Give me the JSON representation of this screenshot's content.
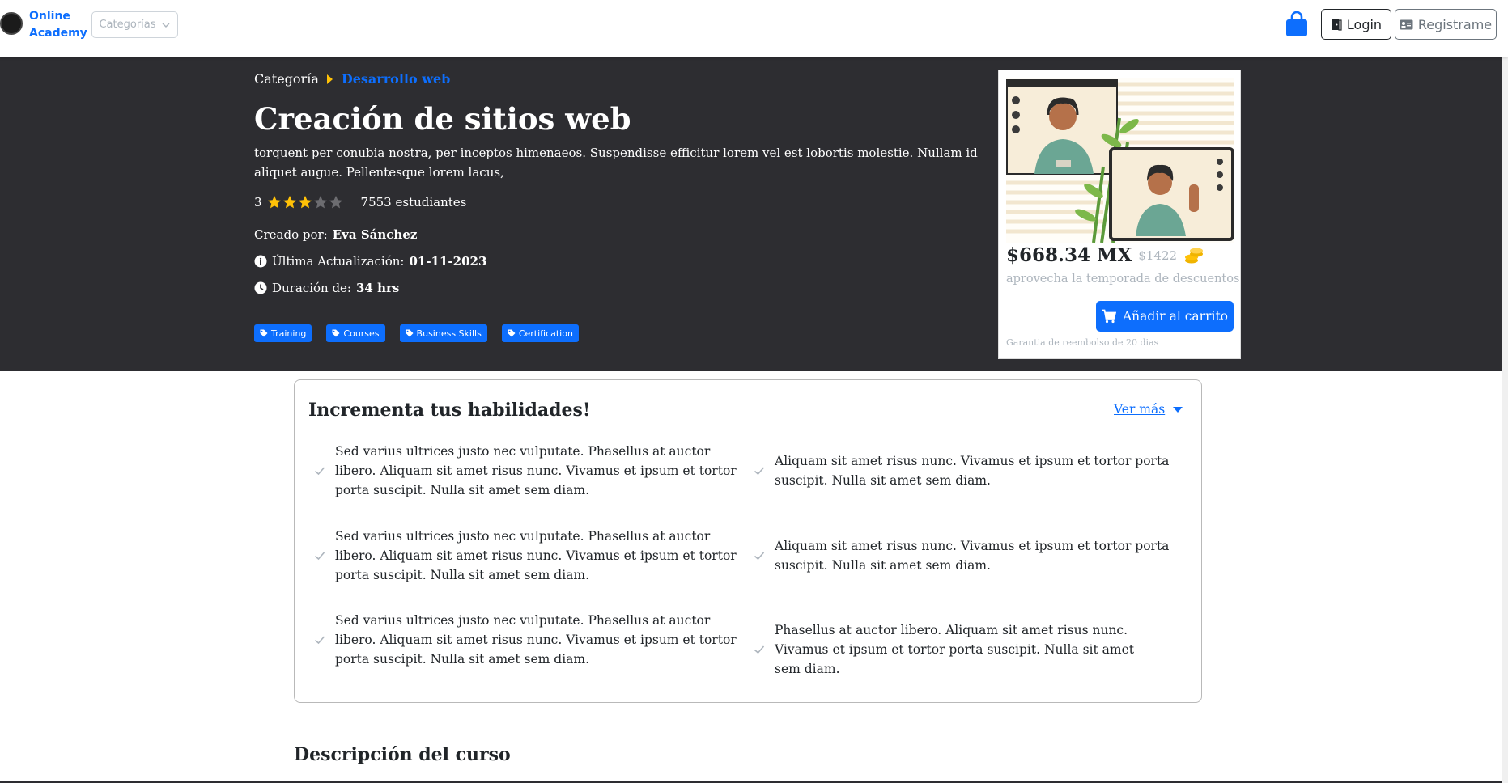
{
  "navbar": {
    "brand": "Online Academy",
    "categories_label": "Categorías",
    "login_label": "Login",
    "register_label": "Registrame",
    "icons": [
      "logo-avatar",
      "chevron-down-icon",
      "shopping-bag-icon",
      "door-icon",
      "id-card-icon"
    ]
  },
  "hero": {
    "breadcrumb": {
      "root": "Categoría",
      "current": "Desarrollo web"
    },
    "title": "Creación de sitios web",
    "description": "torquent per conubia nostra, per inceptos himenaeos. Suspendisse efficitur lorem vel est lobortis molestie. Nullam id aliquet augue. Pellentesque lorem lacus,",
    "rating": "3",
    "rating_value": 3,
    "rating_max": 5,
    "students": "7553 estudiantes",
    "created_by_label": "Creado por:",
    "created_by": "Eva Sánchez",
    "updated_label": "Última Actualización:",
    "updated": "01-11-2023",
    "duration_label": "Duración de:",
    "duration": "34 hrs",
    "tags": [
      "Training",
      "Courses",
      "Business Skills",
      "Certification"
    ]
  },
  "price_card": {
    "price": "$668.34 MX",
    "old_price": "$1422",
    "note": "aprovecha la temporada de descuentos",
    "add_to_cart": "Añadir al carrito",
    "guarantee": "Garantia de reembolso de 20 dias"
  },
  "skills": {
    "title": "Incrementa tus habilidades!",
    "see_more": "Ver más",
    "items": [
      "Sed varius ultrices justo nec vulputate. Phasellus at auctor libero. Aliquam sit amet risus nunc. Vivamus et ipsum et tortor porta suscipit. Nulla sit amet sem diam.",
      "Aliquam sit amet risus nunc. Vivamus et ipsum et tortor porta suscipit. Nulla sit amet sem diam.",
      "Sed varius ultrices justo nec vulputate. Phasellus at auctor libero. Aliquam sit amet risus nunc. Vivamus et ipsum et tortor porta suscipit. Nulla sit amet sem diam.",
      "Aliquam sit amet risus nunc. Vivamus et ipsum et tortor porta suscipit. Nulla sit amet sem diam.",
      "Sed varius ultrices justo nec vulputate. Phasellus at auctor libero. Aliquam sit amet risus nunc. Vivamus et ipsum et tortor porta suscipit. Nulla sit amet sem diam.",
      "Phasellus at auctor libero. Aliquam sit amet risus nunc. Vivamus et ipsum et tortor porta suscipit. Nulla sit amet sem diam."
    ]
  },
  "description_title": "Descripción del curso",
  "colors": {
    "primary": "#0d6efd",
    "hero_bg": "#2d2d31",
    "star": "#ffc107",
    "muted": "#adb5bd"
  }
}
